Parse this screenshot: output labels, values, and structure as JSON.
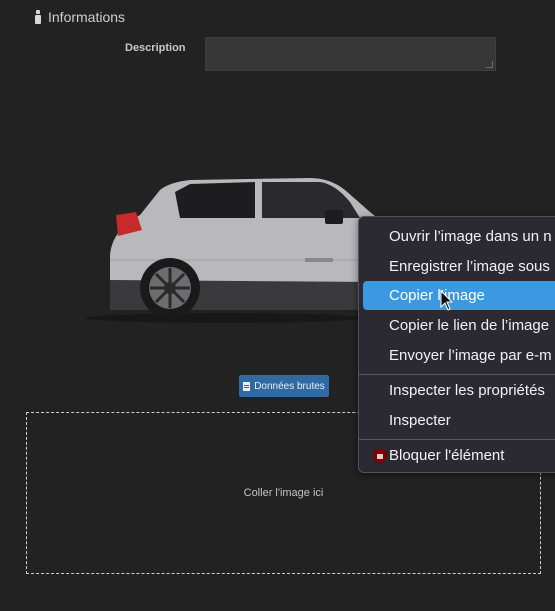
{
  "section": {
    "title": "Informations",
    "icon": "info-icon"
  },
  "form": {
    "description_label": "Description",
    "description_value": ""
  },
  "image": {
    "subject": "car-image"
  },
  "raw_button": {
    "label": "Données brutes",
    "icon": "document-icon"
  },
  "drop_zone": {
    "text": "Coller l'image ici"
  },
  "context_menu": {
    "items": [
      {
        "label": "Ouvrir l’image dans un n"
      },
      {
        "label": "Enregistrer l’image sous"
      },
      {
        "label": "Copier l’image"
      },
      {
        "label": "Copier le lien de l’image"
      },
      {
        "label": "Envoyer l’image par e-m"
      },
      {
        "label": "Inspecter les propriétés"
      },
      {
        "label": "Inspecter"
      },
      {
        "label": "Bloquer l'élément"
      }
    ],
    "highlighted_index": 2,
    "highlight_color": "#3a99e0"
  },
  "colors": {
    "background": "#222222",
    "button": "#2f6aa4",
    "menu_bg": "#2b2a33"
  }
}
